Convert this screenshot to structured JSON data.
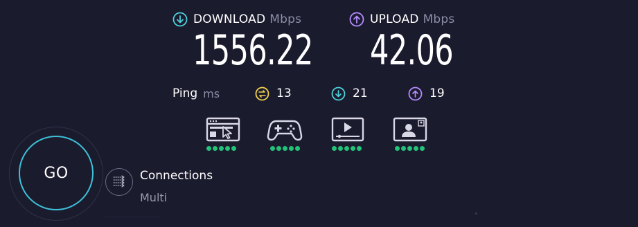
{
  "download": {
    "label": "DOWNLOAD",
    "unit": "Mbps",
    "value": "1556.22",
    "icon": "download-arrow-icon",
    "color": "#4fd1d9"
  },
  "upload": {
    "label": "UPLOAD",
    "unit": "Mbps",
    "value": "42.06",
    "icon": "upload-arrow-icon",
    "color": "#b58cff"
  },
  "ping": {
    "label": "Ping",
    "unit": "ms",
    "idle": {
      "value": "13",
      "icon": "idle-ping-icon",
      "color": "#f2d24b"
    },
    "download": {
      "value": "21",
      "icon": "download-ping-icon",
      "color": "#4fd1d9"
    },
    "upload": {
      "value": "19",
      "icon": "upload-ping-icon",
      "color": "#b58cff"
    }
  },
  "experience": [
    {
      "icon": "web-browsing-icon",
      "rating": 5
    },
    {
      "icon": "gaming-controller-icon",
      "rating": 5
    },
    {
      "icon": "video-streaming-icon",
      "rating": 5
    },
    {
      "icon": "video-call-icon",
      "rating": 5
    }
  ],
  "rating_color": "#23c279",
  "go_button": {
    "label": "GO",
    "ring_color": "#3ec1d8"
  },
  "connections": {
    "title": "Connections",
    "value": "Multi",
    "icon": "connections-icon"
  }
}
